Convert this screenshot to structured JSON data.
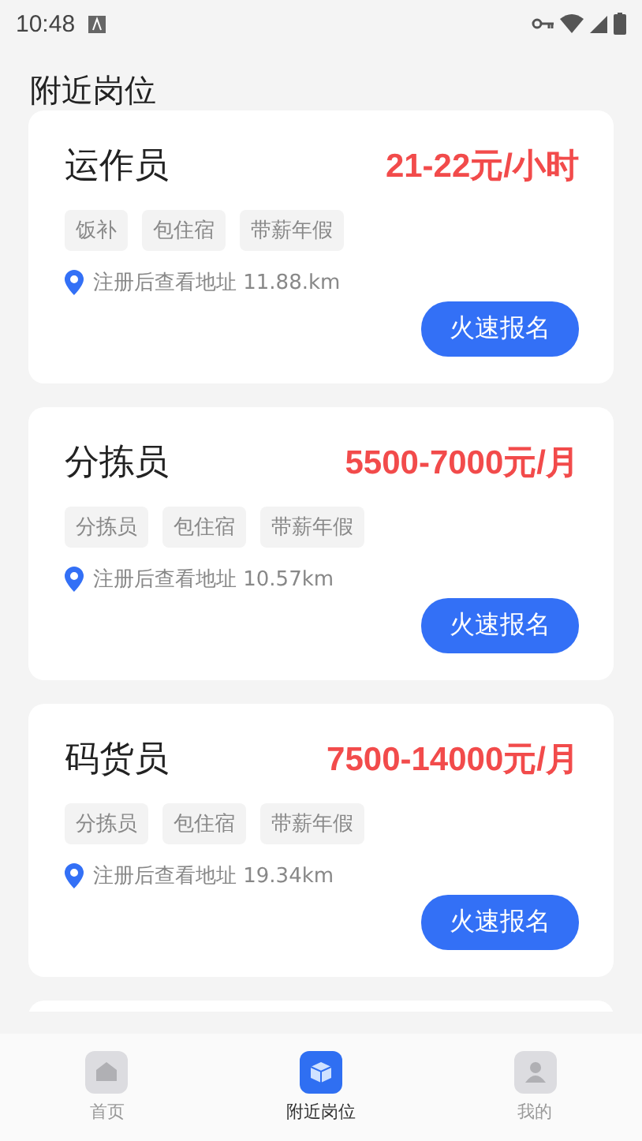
{
  "status_bar": {
    "time": "10:48"
  },
  "title": "附近岗位",
  "jobs": [
    {
      "name": "运作员",
      "salary": "21-22元/小时",
      "tags": [
        "饭补",
        "包住宿",
        "带薪年假"
      ],
      "address": "注册后查看地址 11.88.km",
      "button": "火速报名"
    },
    {
      "name": "分拣员",
      "salary": "5500-7000元/月",
      "tags": [
        "分拣员",
        "包住宿",
        "带薪年假"
      ],
      "address": "注册后查看地址 10.57km",
      "button": "火速报名"
    },
    {
      "name": "码货员",
      "salary": "7500-14000元/月",
      "tags": [
        "分拣员",
        "包住宿",
        "带薪年假"
      ],
      "address": "注册后查看地址 19.34km",
      "button": "火速报名"
    }
  ],
  "tab_bar": [
    {
      "label": "首页",
      "kind": "home",
      "selected": false
    },
    {
      "label": "附近岗位",
      "kind": "box",
      "selected": true
    },
    {
      "label": "我的",
      "kind": "user",
      "selected": false
    }
  ]
}
